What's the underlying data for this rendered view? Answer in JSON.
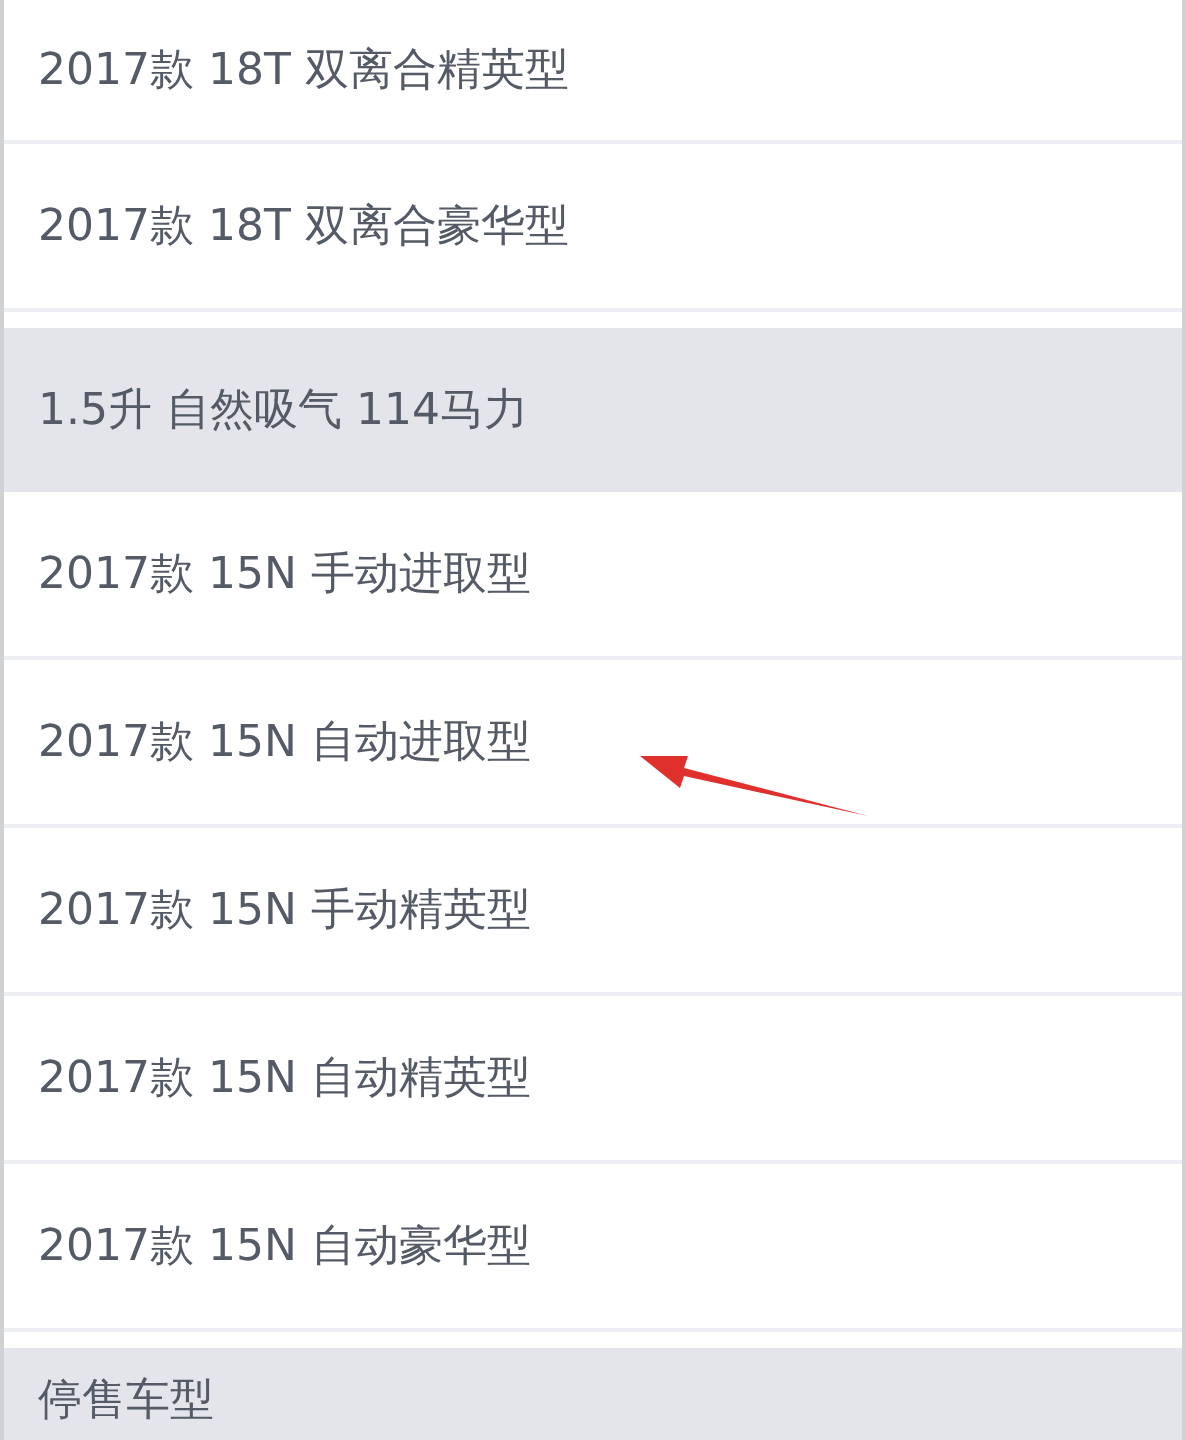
{
  "groups": [
    {
      "items": [
        {
          "label": "2017款 18T 双离合精英型",
          "marked": false
        },
        {
          "label": "2017款 18T 双离合豪华型",
          "marked": false
        }
      ]
    },
    {
      "header": "1.5升 自然吸气 114马力",
      "items": [
        {
          "label": "2017款 15N 手动进取型",
          "marked": false
        },
        {
          "label": "2017款 15N 自动进取型",
          "marked": true
        },
        {
          "label": "2017款 15N 手动精英型",
          "marked": false
        },
        {
          "label": "2017款 15N 自动精英型",
          "marked": false
        },
        {
          "label": "2017款 15N 自动豪华型",
          "marked": false
        }
      ]
    },
    {
      "header": "停售车型"
    }
  ]
}
